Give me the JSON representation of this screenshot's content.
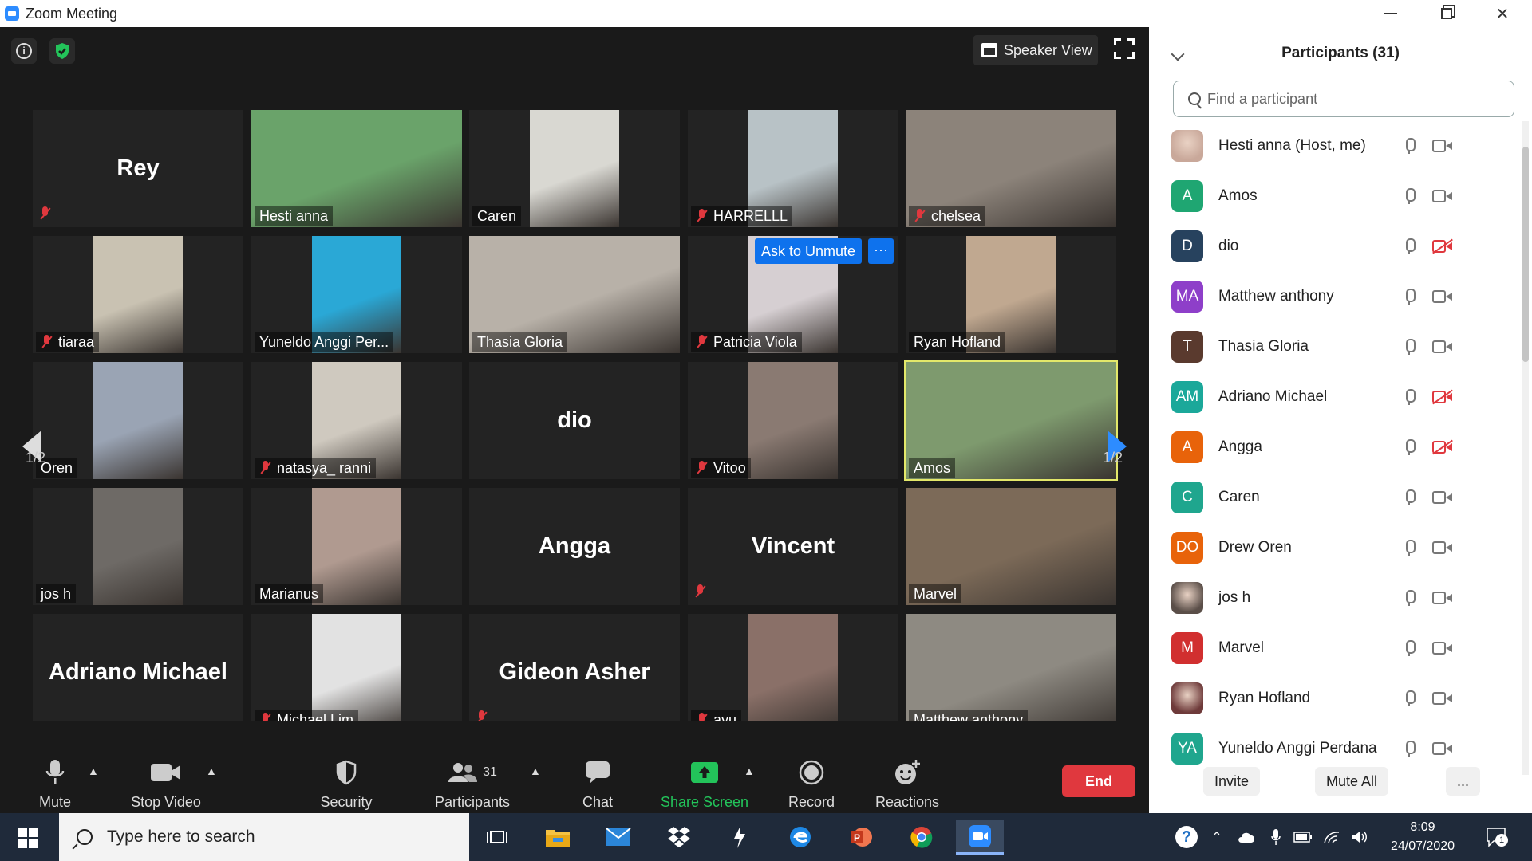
{
  "window": {
    "title": "Zoom Meeting",
    "controls": [
      "minimize",
      "restore",
      "close"
    ]
  },
  "meeting": {
    "view_button": "Speaker View",
    "page_indicator_left": "1/2",
    "page_indicator_right": "1/2",
    "ask_to_unmute": "Ask to Unmute",
    "more_dots": "···",
    "tiles": [
      {
        "name": "Rey",
        "video": false,
        "muted": true,
        "show_label": false
      },
      {
        "name": "Hesti anna",
        "video": true,
        "muted": false,
        "bg": "#6aa36a"
      },
      {
        "name": "Caren",
        "video": true,
        "muted": false,
        "bg": "#d9d8d2",
        "narrow": true
      },
      {
        "name": "HARRELLL",
        "video": true,
        "muted": true,
        "bg": "#b8c2c6",
        "narrow": true
      },
      {
        "name": "chelsea",
        "video": true,
        "muted": true,
        "bg": "#8c837a"
      },
      {
        "name": "tiaraa",
        "video": true,
        "muted": true,
        "bg": "#c9c2b2",
        "narrow": true
      },
      {
        "name": "Yuneldo Anggi Per...",
        "video": true,
        "muted": false,
        "bg": "#2aa8d6",
        "narrow": true
      },
      {
        "name": "Thasia Gloria",
        "video": true,
        "muted": false,
        "bg": "#b8b1a8"
      },
      {
        "name": "Patricia Viola",
        "video": true,
        "muted": true,
        "bg": "#d6cfd2",
        "narrow": true
      },
      {
        "name": "Ryan Hofland",
        "video": true,
        "muted": false,
        "bg": "#c0a890",
        "narrow": true
      },
      {
        "name": "Drew Oren",
        "label_text": "Oren",
        "video": true,
        "muted": false,
        "bg": "#9aa4b4",
        "narrow": true
      },
      {
        "name": "natasya_ ranni",
        "video": true,
        "muted": true,
        "bg": "#cfc9bf",
        "narrow": true
      },
      {
        "name": "dio",
        "video": false,
        "muted": false,
        "show_label": false
      },
      {
        "name": "Vitoo",
        "video": true,
        "muted": true,
        "bg": "#8a7a72",
        "narrow": true
      },
      {
        "name": "Amos",
        "video": true,
        "muted": false,
        "bg": "#7e9a6e",
        "active": true
      },
      {
        "name": "jos h",
        "video": true,
        "muted": false,
        "bg": "#6e6a66",
        "narrow": true
      },
      {
        "name": "Marianus",
        "video": true,
        "muted": false,
        "bg": "#b09a90",
        "narrow": true
      },
      {
        "name": "Angga",
        "video": false,
        "muted": false,
        "show_label": false
      },
      {
        "name": "Vincent",
        "video": false,
        "muted": true,
        "show_label": false
      },
      {
        "name": "Marvel",
        "video": true,
        "muted": false,
        "bg": "#7c6a58"
      },
      {
        "name": "Adriano Michael",
        "video": false,
        "muted": false,
        "show_label": false
      },
      {
        "name": "Michael Lim",
        "video": true,
        "muted": true,
        "bg": "#e2e2e2",
        "narrow": true
      },
      {
        "name": "Gideon Asher",
        "video": false,
        "muted": true,
        "show_label": false
      },
      {
        "name": "ayu",
        "video": true,
        "muted": true,
        "bg": "#8a7068",
        "narrow": true
      },
      {
        "name": "Matthew anthony",
        "video": true,
        "muted": false,
        "bg": "#8e8a82"
      }
    ]
  },
  "toolbar": {
    "mute": "Mute",
    "stop_video": "Stop Video",
    "security": "Security",
    "participants": "Participants",
    "participants_count": "31",
    "chat": "Chat",
    "share_screen": "Share Screen",
    "record": "Record",
    "reactions": "Reactions",
    "end": "End"
  },
  "panel": {
    "title": "Participants (31)",
    "search_placeholder": "Find a participant",
    "participants": [
      {
        "name": "Hesti anna (Host, me)",
        "initials": "",
        "color": "#c9a89a",
        "photo": true,
        "video_off": false
      },
      {
        "name": "Amos",
        "initials": "A",
        "color": "#1fa672",
        "video_off": false
      },
      {
        "name": "dio",
        "initials": "D",
        "color": "#27425e",
        "video_off": true
      },
      {
        "name": "Matthew anthony",
        "initials": "MA",
        "color": "#8e3fc9",
        "video_off": false
      },
      {
        "name": "Thasia Gloria",
        "initials": "T",
        "color": "#5a3a2e",
        "video_off": false
      },
      {
        "name": "Adriano Michael",
        "initials": "AM",
        "color": "#1ba89a",
        "video_off": true
      },
      {
        "name": "Angga",
        "initials": "A",
        "color": "#e8630a",
        "video_off": true
      },
      {
        "name": "Caren",
        "initials": "C",
        "color": "#1fa68e",
        "video_off": false
      },
      {
        "name": "Drew Oren",
        "initials": "DO",
        "color": "#e8630a",
        "video_off": false
      },
      {
        "name": "jos h",
        "initials": "",
        "color": "#5a4e48",
        "photo": true,
        "video_off": false
      },
      {
        "name": "Marvel",
        "initials": "M",
        "color": "#d12f2f",
        "video_off": false
      },
      {
        "name": "Ryan Hofland",
        "initials": "",
        "color": "#6e3a3a",
        "photo": true,
        "video_off": false
      },
      {
        "name": "Yuneldo Anggi Perdana",
        "initials": "YA",
        "color": "#1fa68e",
        "video_off": false
      }
    ],
    "invite": "Invite",
    "mute_all": "Mute All",
    "more": "..."
  },
  "taskbar": {
    "search_placeholder": "Type here to search",
    "time": "8:09",
    "date": "24/07/2020",
    "notification_count": "1",
    "apps": [
      "task-view",
      "file-explorer",
      "mail",
      "dropbox",
      "app-bolt",
      "edge",
      "powerpoint",
      "chrome",
      "zoom"
    ]
  }
}
